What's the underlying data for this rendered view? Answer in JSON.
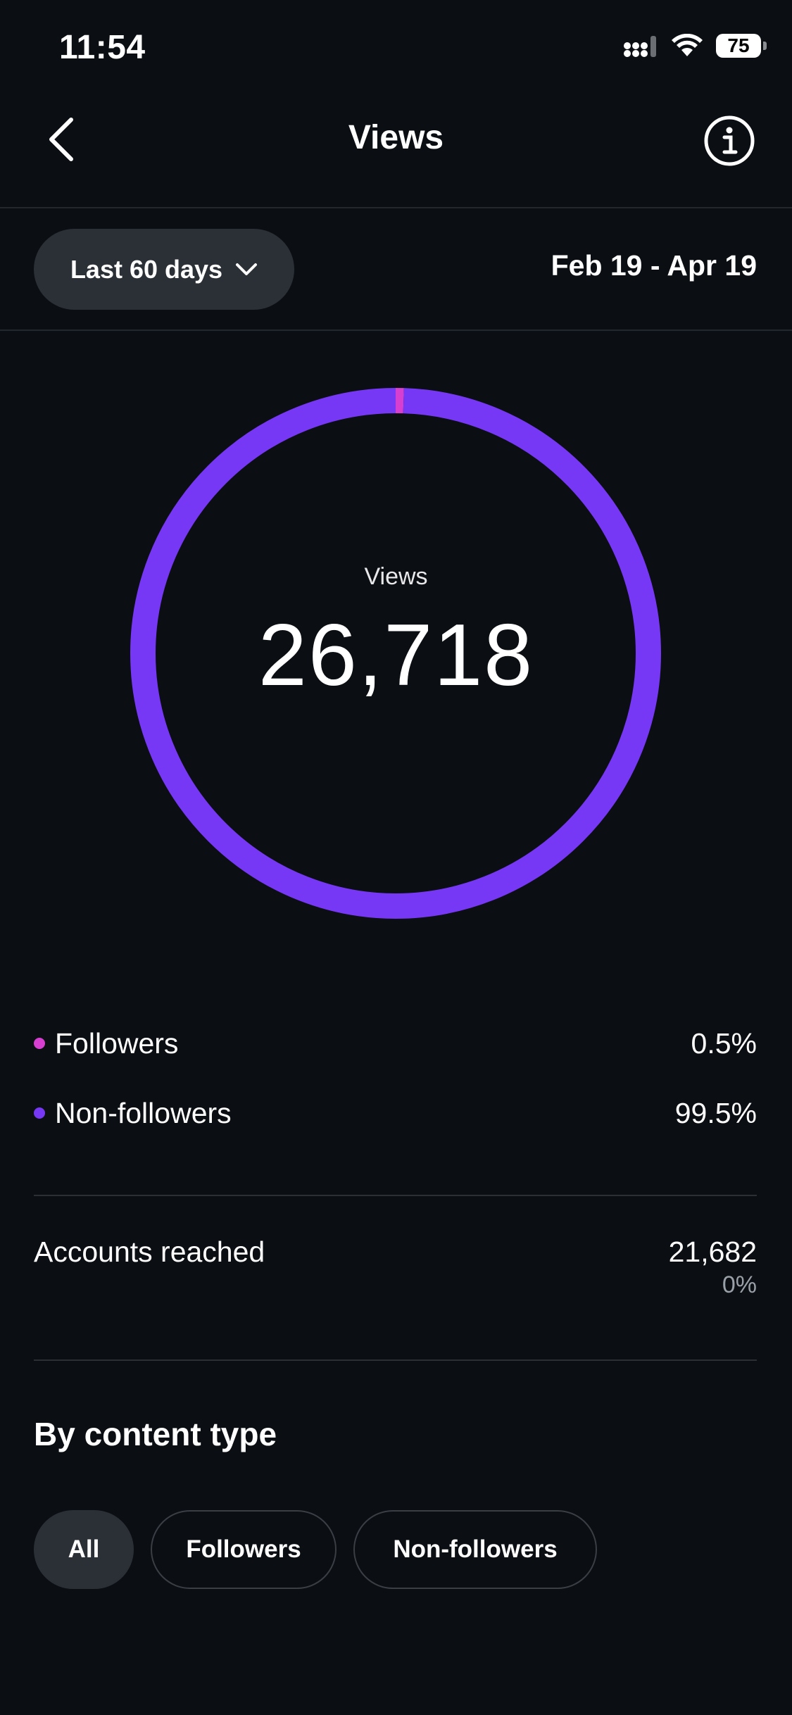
{
  "status_bar": {
    "time": "11:54",
    "battery": "75",
    "icons": [
      "cellular-signal-icon",
      "wifi-icon",
      "battery-icon"
    ]
  },
  "header": {
    "title": "Views",
    "back_icon": "chevron-left-icon",
    "info_icon": "info-icon"
  },
  "date_filter": {
    "range_label": "Last 60 days",
    "dropdown_icon": "chevron-down-icon",
    "date_range": "Feb 19 - Apr 19"
  },
  "summary": {
    "label": "Views",
    "value": "26,718"
  },
  "chart_data": {
    "type": "pie",
    "categories": [
      "Followers",
      "Non-followers"
    ],
    "values": [
      0.5,
      99.5
    ],
    "colors": [
      "#d63fd0",
      "#7738f5"
    ],
    "center_label": "Views",
    "center_value": "26,718"
  },
  "legend": [
    {
      "label": "Followers",
      "value": "0.5%",
      "color": "#d63fd0"
    },
    {
      "label": "Non-followers",
      "value": "99.5%",
      "color": "#7738f5"
    }
  ],
  "accounts_reached": {
    "label": "Accounts reached",
    "value": "21,682",
    "change": "0%"
  },
  "content_type": {
    "title": "By content type",
    "filters": [
      {
        "label": "All",
        "active": true
      },
      {
        "label": "Followers",
        "active": false
      },
      {
        "label": "Non-followers",
        "active": false
      }
    ]
  },
  "colors": {
    "background": "#0b0e13",
    "accent": "#7738f5",
    "pill": "#2b2f36"
  }
}
